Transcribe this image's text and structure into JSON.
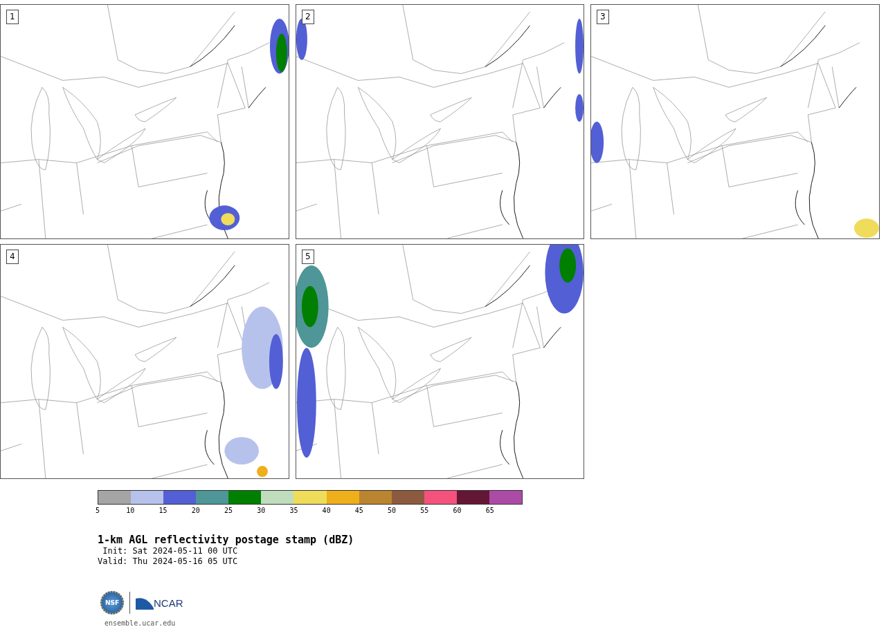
{
  "panels": [
    {
      "label": "1"
    },
    {
      "label": "2"
    },
    {
      "label": "3"
    },
    {
      "label": "4"
    },
    {
      "label": "5"
    }
  ],
  "colorbar": {
    "segments": [
      {
        "color": "#a5a5a5"
      },
      {
        "color": "#b7c2ec"
      },
      {
        "color": "#535fd4"
      },
      {
        "color": "#4f9698"
      },
      {
        "color": "#007f00"
      },
      {
        "color": "#bfddbd"
      },
      {
        "color": "#efdc5b"
      },
      {
        "color": "#eeaf1a"
      },
      {
        "color": "#bb842f"
      },
      {
        "color": "#8b5a3f"
      },
      {
        "color": "#f4527d"
      },
      {
        "color": "#631734"
      },
      {
        "color": "#ac4ba6"
      }
    ],
    "ticks": [
      "5",
      "10",
      "15",
      "20",
      "25",
      "30",
      "35",
      "40",
      "45",
      "50",
      "55",
      "60",
      "65"
    ]
  },
  "title": "1-km AGL reflectivity postage stamp (dBZ)",
  "init": " Init: Sat 2024-05-11 00 UTC",
  "valid": "Valid: Thu 2024-05-16 05 UTC",
  "logo": {
    "left": "NSF",
    "right": "NCAR"
  },
  "footer": "ensemble.ucar.edu"
}
